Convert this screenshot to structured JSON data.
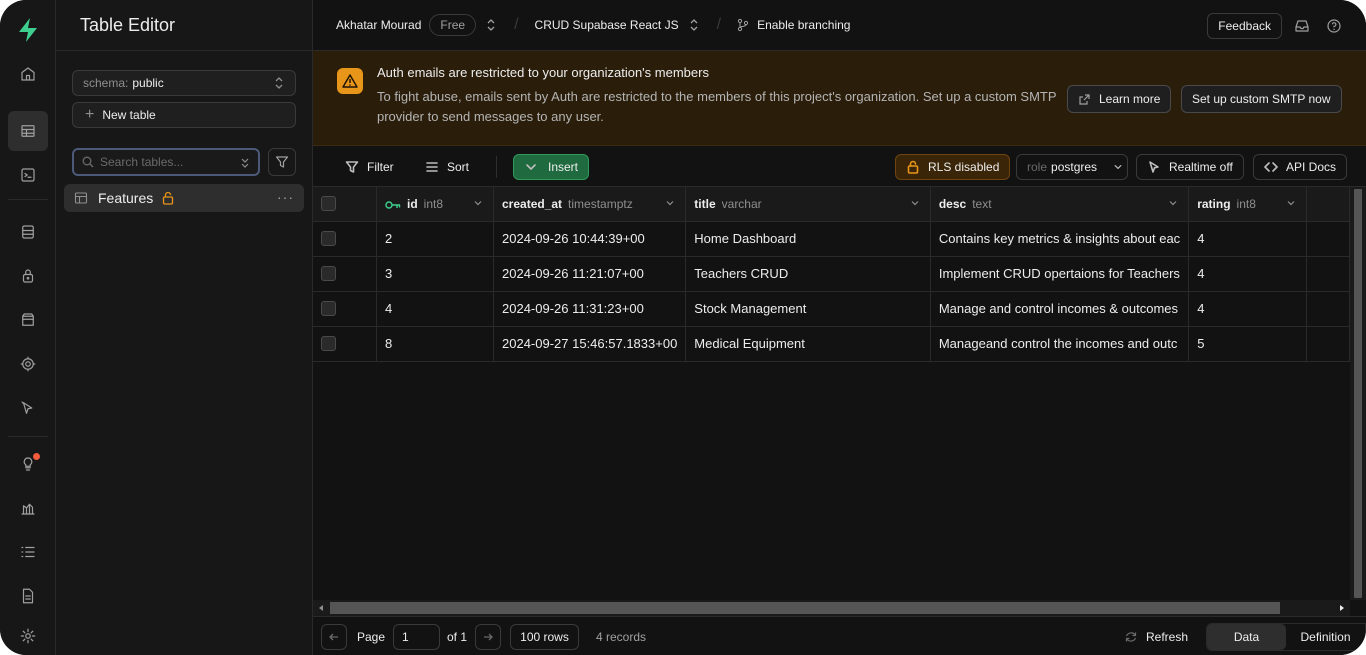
{
  "panel": {
    "title": "Table Editor",
    "schema_label": "schema:",
    "schema_value": "public",
    "new_table": "New table",
    "search_placeholder": "Search tables...",
    "table_name": "Features"
  },
  "topbar": {
    "org": "Akhatar Mourad",
    "plan": "Free",
    "project": "CRUD Supabase React JS",
    "branching": "Enable branching",
    "feedback": "Feedback"
  },
  "banner": {
    "title": "Auth emails are restricted to your organization's members",
    "description": "To fight abuse, emails sent by Auth are restricted to the members of this project's organization. Set up a custom SMTP provider to send messages to any user.",
    "learn_more": "Learn more",
    "smtp_button": "Set up custom SMTP now"
  },
  "toolbar": {
    "filter": "Filter",
    "sort": "Sort",
    "insert": "Insert",
    "rls": "RLS disabled",
    "role_label": "role",
    "role_value": "postgres",
    "realtime": "Realtime off",
    "api_docs": "API Docs"
  },
  "columns": [
    {
      "name": "id",
      "type": "int8"
    },
    {
      "name": "created_at",
      "type": "timestamptz"
    },
    {
      "name": "title",
      "type": "varchar"
    },
    {
      "name": "desc",
      "type": "text"
    },
    {
      "name": "rating",
      "type": "int8"
    }
  ],
  "rows": [
    {
      "id": "2",
      "created_at": "2024-09-26 10:44:39+00",
      "title": "Home Dashboard",
      "desc": "Contains key metrics & insights about eac",
      "rating": "4"
    },
    {
      "id": "3",
      "created_at": "2024-09-26 11:21:07+00",
      "title": "Teachers CRUD",
      "desc": "Implement CRUD opertaions for Teachers",
      "rating": "4"
    },
    {
      "id": "4",
      "created_at": "2024-09-26 11:31:23+00",
      "title": "Stock Management",
      "desc": "Manage and control incomes & outcomes",
      "rating": "4"
    },
    {
      "id": "8",
      "created_at": "2024-09-27 15:46:57.1833+00",
      "title": "Medical Equipment",
      "desc": "Manageand control the incomes and outc",
      "rating": "5"
    }
  ],
  "footer": {
    "page_label": "Page",
    "page_value": "1",
    "of": "of 1",
    "rows": "100 rows",
    "records": "4 records",
    "refresh": "Refresh",
    "data_tab": "Data",
    "definition_tab": "Definition"
  },
  "colors": {
    "accent_green": "#3ecf8e",
    "warning": "#e8961a",
    "background": "#121212"
  }
}
